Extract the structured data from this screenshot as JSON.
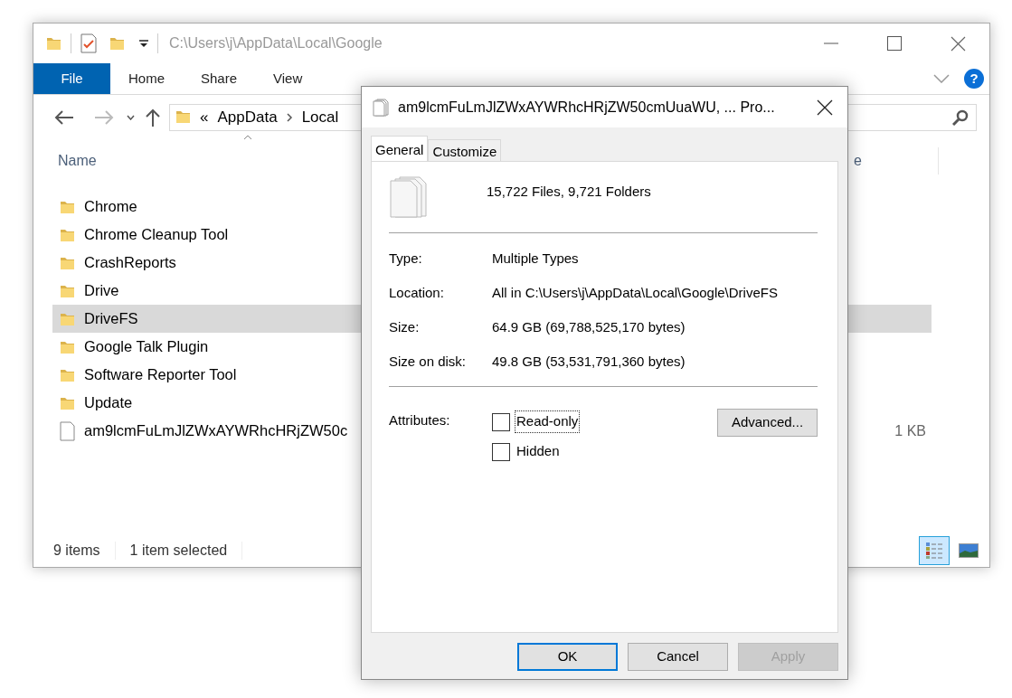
{
  "explorer": {
    "title": "C:\\Users\\j\\AppData\\Local\\Google",
    "file_tab": "File",
    "ribbon_tabs": [
      "Home",
      "Share",
      "View"
    ],
    "help_label": "?",
    "nav": {
      "back_enabled": true,
      "forward_enabled": false
    },
    "breadcrumb_overflow": "«",
    "breadcrumb": [
      "AppData",
      "Local"
    ],
    "column_headers": [
      "Name",
      "e"
    ],
    "files": [
      {
        "kind": "folder",
        "name": "Chrome",
        "selected": false
      },
      {
        "kind": "folder",
        "name": "Chrome Cleanup Tool",
        "selected": false
      },
      {
        "kind": "folder",
        "name": "CrashReports",
        "selected": false
      },
      {
        "kind": "folder",
        "name": "Drive",
        "selected": false
      },
      {
        "kind": "folder",
        "name": "DriveFS",
        "selected": true
      },
      {
        "kind": "folder",
        "name": "Google Talk Plugin",
        "selected": false
      },
      {
        "kind": "folder",
        "name": "Software Reporter Tool",
        "selected": false
      },
      {
        "kind": "folder",
        "name": "Update",
        "selected": false
      },
      {
        "kind": "file",
        "name": "am9lcmFuLmJlZWxAYWRhcHRjZW50c",
        "size": "1 KB",
        "selected": false
      }
    ],
    "status": [
      "9 items",
      "1 item selected"
    ],
    "view_buttons": [
      {
        "kind": "details",
        "selected": true
      },
      {
        "kind": "thumbnails",
        "selected": false
      }
    ]
  },
  "dialog": {
    "title": "am9lcmFuLmJlZWxAYWRhcHRjZW50cmUuaWU, ... Pro...",
    "tabs": [
      {
        "label": "General",
        "selected": true
      },
      {
        "label": "Customize",
        "selected": false
      }
    ],
    "summary": "15,722 Files, 9,721 Folders",
    "properties_top": [
      {
        "label": "Type:",
        "value": "Multiple Types"
      },
      {
        "label": "Location:",
        "value": "All in C:\\Users\\j\\AppData\\Local\\Google\\DriveFS"
      },
      {
        "label": "Size:",
        "value": "64.9 GB (69,788,525,170 bytes)"
      },
      {
        "label": "Size on disk:",
        "value": "49.8 GB (53,531,791,360 bytes)"
      }
    ],
    "attributes_label": "Attributes:",
    "attributes": [
      {
        "label": "Read-only",
        "checked": false,
        "focused": true
      },
      {
        "label": "Hidden",
        "checked": false,
        "focused": false
      }
    ],
    "advanced_button": "Advanced...",
    "buttons": [
      {
        "label": "OK",
        "default": true,
        "disabled": false
      },
      {
        "label": "Cancel",
        "default": false,
        "disabled": false
      },
      {
        "label": "Apply",
        "default": false,
        "disabled": true
      }
    ]
  }
}
